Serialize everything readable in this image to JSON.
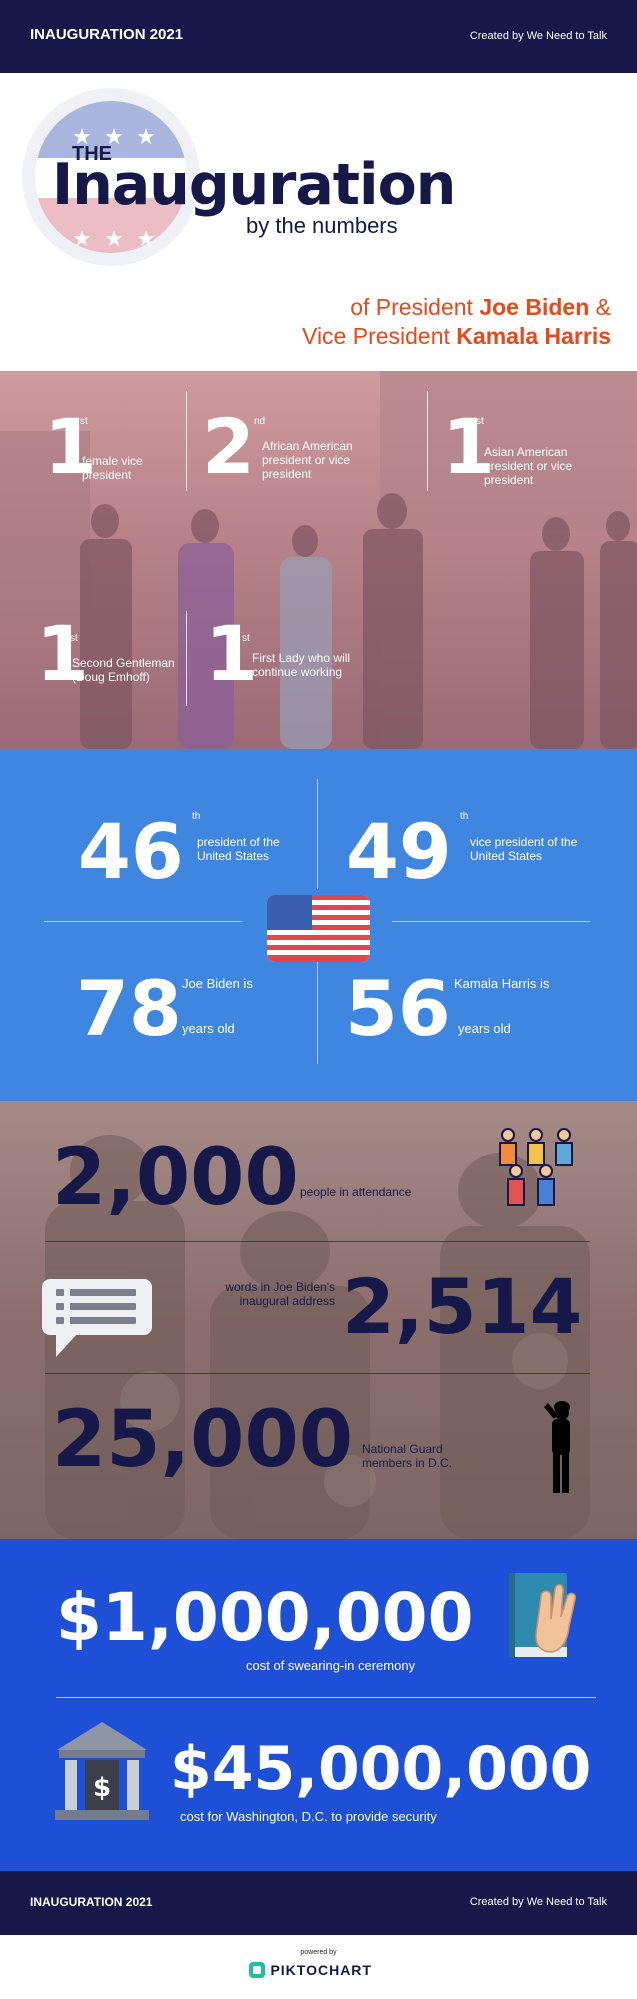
{
  "header": {
    "title": "INAUGURATION 2021",
    "credit": "Created by We Need to Talk"
  },
  "hero": {
    "the": "THE",
    "title": "Inauguration",
    "subtitle": "by the numbers",
    "line1_prefix": "of President ",
    "line1_name": "Joe Biden",
    "line1_suffix": " &",
    "line2_prefix": "Vice President ",
    "line2_name": "Kamala Harris"
  },
  "firsts": [
    {
      "num": "1",
      "sup": "st",
      "text": "female vice president"
    },
    {
      "num": "2",
      "sup": "nd",
      "text": "African American president or vice president"
    },
    {
      "num": "1",
      "sup": "st",
      "text": "Asian American president or vice president"
    },
    {
      "num": "1",
      "sup": "st",
      "text": "Second Gentleman (Doug Emhoff)"
    },
    {
      "num": "1",
      "sup": "st",
      "text": "First Lady who will continue working"
    }
  ],
  "numbers": {
    "president_num": "46",
    "president_sup": "th",
    "president_text": "president of the United States",
    "vp_num": "49",
    "vp_sup": "th",
    "vp_text": "vice president of the United States",
    "biden_age": "78",
    "biden_pre": "Joe Biden is",
    "biden_post": "years old",
    "harris_age": "56",
    "harris_pre": "Kamala Harris is",
    "harris_post": "years old"
  },
  "stats": {
    "attendance_num": "2,000",
    "attendance_text": "people in attendance",
    "words_num": "2,514",
    "words_text": "words in Joe Biden's inaugural address",
    "guard_num": "25,000",
    "guard_text": "National Guard members in D.C."
  },
  "costs": {
    "ceremony_num": "$1,000,000",
    "ceremony_text": "cost of swearing-in ceremony",
    "security_num": "$45,000,000",
    "security_text": "cost for Washington, D.C. to provide security"
  },
  "footer": {
    "title": "INAUGURATION 2021",
    "credit": "Created by We Need to Talk",
    "powered": "powered by",
    "brand": "PIKTOCHART"
  },
  "colors": {
    "navy": "#151848",
    "orange": "#e5491c",
    "blue": "#3f86e0",
    "royal": "#1d4fd7"
  }
}
